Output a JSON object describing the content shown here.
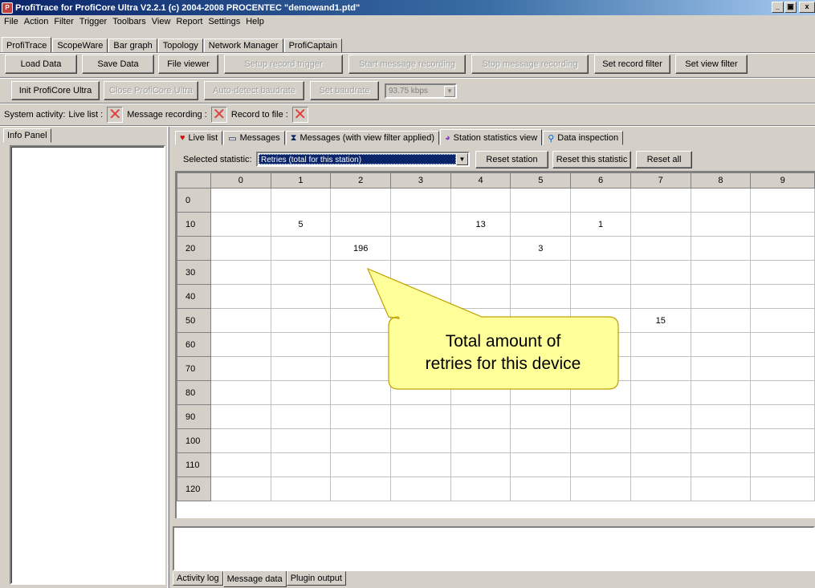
{
  "window": {
    "title": "ProfiTrace for ProfiCore Ultra V2.2.1 (c) 2004-2008 PROCENTEC  \"demowand1.ptd\"",
    "controls": [
      "_",
      "▣",
      "x"
    ]
  },
  "menu": [
    "File",
    "Action",
    "Filter",
    "Trigger",
    "Toolbars",
    "View",
    "Report",
    "Settings",
    "Help"
  ],
  "top_tabs": [
    "ProfiTrace",
    "ScopeWare",
    "Bar graph",
    "Topology",
    "Network Manager",
    "ProfiCaptain"
  ],
  "toolbar1": {
    "load_data": "Load Data",
    "save_data": "Save Data",
    "file_viewer": "File viewer",
    "setup_record_trigger": "Setup record trigger",
    "start_message_recording": "Start message recording",
    "stop_message_recording": "Stop message recording",
    "set_record_filter": "Set record filter",
    "set_view_filter": "Set view filter"
  },
  "toolbar2": {
    "init_proficore": "Init ProfiCore Ultra",
    "close_proficore": "Close ProfiCore Ultra",
    "auto_detect_baudrate": "Auto-detect baudrate",
    "set_baudrate": "Set baudrate",
    "baudrate_value": "93.75 kbps"
  },
  "status": {
    "system_activity": "System activity:",
    "live_list": "Live list :",
    "message_recording": "Message recording :",
    "record_to_file": "Record to file :"
  },
  "info_panel": {
    "tab": "Info Panel"
  },
  "view_tabs": [
    {
      "label": "Live list",
      "icon": "heart-icon"
    },
    {
      "label": "Messages",
      "icon": "messages-icon"
    },
    {
      "label": "Messages (with view filter applied)",
      "icon": "filter-icon"
    },
    {
      "label": "Station statistics view",
      "icon": "statistics-icon"
    },
    {
      "label": "Data inspection",
      "icon": "magnifier-icon"
    }
  ],
  "statistics_bar": {
    "selected_label": "Selected statistic:",
    "selected_value": "Retries (total for this station)",
    "reset_station": "Reset station",
    "reset_this_statistic": "Reset this statistic",
    "reset_all": "Reset all"
  },
  "grid": {
    "columns": [
      "0",
      "1",
      "2",
      "3",
      "4",
      "5",
      "6",
      "7",
      "8",
      "9"
    ],
    "rows": [
      {
        "label": "0",
        "cells": [
          "",
          "",
          "",
          "",
          "",
          "",
          "",
          "",
          "",
          ""
        ]
      },
      {
        "label": "10",
        "cells": [
          "",
          "5",
          "",
          "",
          "13",
          "",
          "1",
          "",
          "",
          ""
        ]
      },
      {
        "label": "20",
        "cells": [
          "",
          "",
          "196",
          "",
          "",
          "3",
          "",
          "",
          "",
          ""
        ]
      },
      {
        "label": "30",
        "cells": [
          "",
          "",
          "",
          "",
          "",
          "",
          "",
          "",
          "",
          ""
        ]
      },
      {
        "label": "40",
        "cells": [
          "",
          "",
          "",
          "",
          "",
          "",
          "",
          "",
          "",
          ""
        ]
      },
      {
        "label": "50",
        "cells": [
          "",
          "",
          "",
          "",
          "",
          "",
          "",
          "15",
          "",
          ""
        ]
      },
      {
        "label": "60",
        "cells": [
          "",
          "",
          "",
          "",
          "",
          "",
          "",
          "",
          "",
          ""
        ]
      },
      {
        "label": "70",
        "cells": [
          "",
          "",
          "",
          "",
          "",
          "",
          "",
          "",
          "",
          ""
        ]
      },
      {
        "label": "80",
        "cells": [
          "",
          "",
          "",
          "",
          "",
          "",
          "",
          "",
          "",
          ""
        ]
      },
      {
        "label": "90",
        "cells": [
          "",
          "",
          "",
          "",
          "",
          "",
          "",
          "",
          "",
          ""
        ]
      },
      {
        "label": "100",
        "cells": [
          "",
          "",
          "",
          "",
          "",
          "",
          "",
          "",
          "",
          ""
        ]
      },
      {
        "label": "110",
        "cells": [
          "",
          "",
          "",
          "",
          "",
          "",
          "",
          "",
          "",
          ""
        ]
      },
      {
        "label": "120",
        "cells": [
          "",
          "",
          "",
          "",
          "",
          "",
          "",
          "",
          "",
          ""
        ]
      }
    ]
  },
  "callout": {
    "line1": "Total amount of",
    "line2": "retries for this device",
    "fill": "#ffff99",
    "stroke": "#c0a000"
  },
  "bottom_tabs": [
    "Activity log",
    "Message data",
    "Plugin output"
  ],
  "colors": {
    "titlebar_start": "#0a246a",
    "selection": "#0a246a",
    "error_x": "#e04040",
    "heart": "#d01010"
  }
}
